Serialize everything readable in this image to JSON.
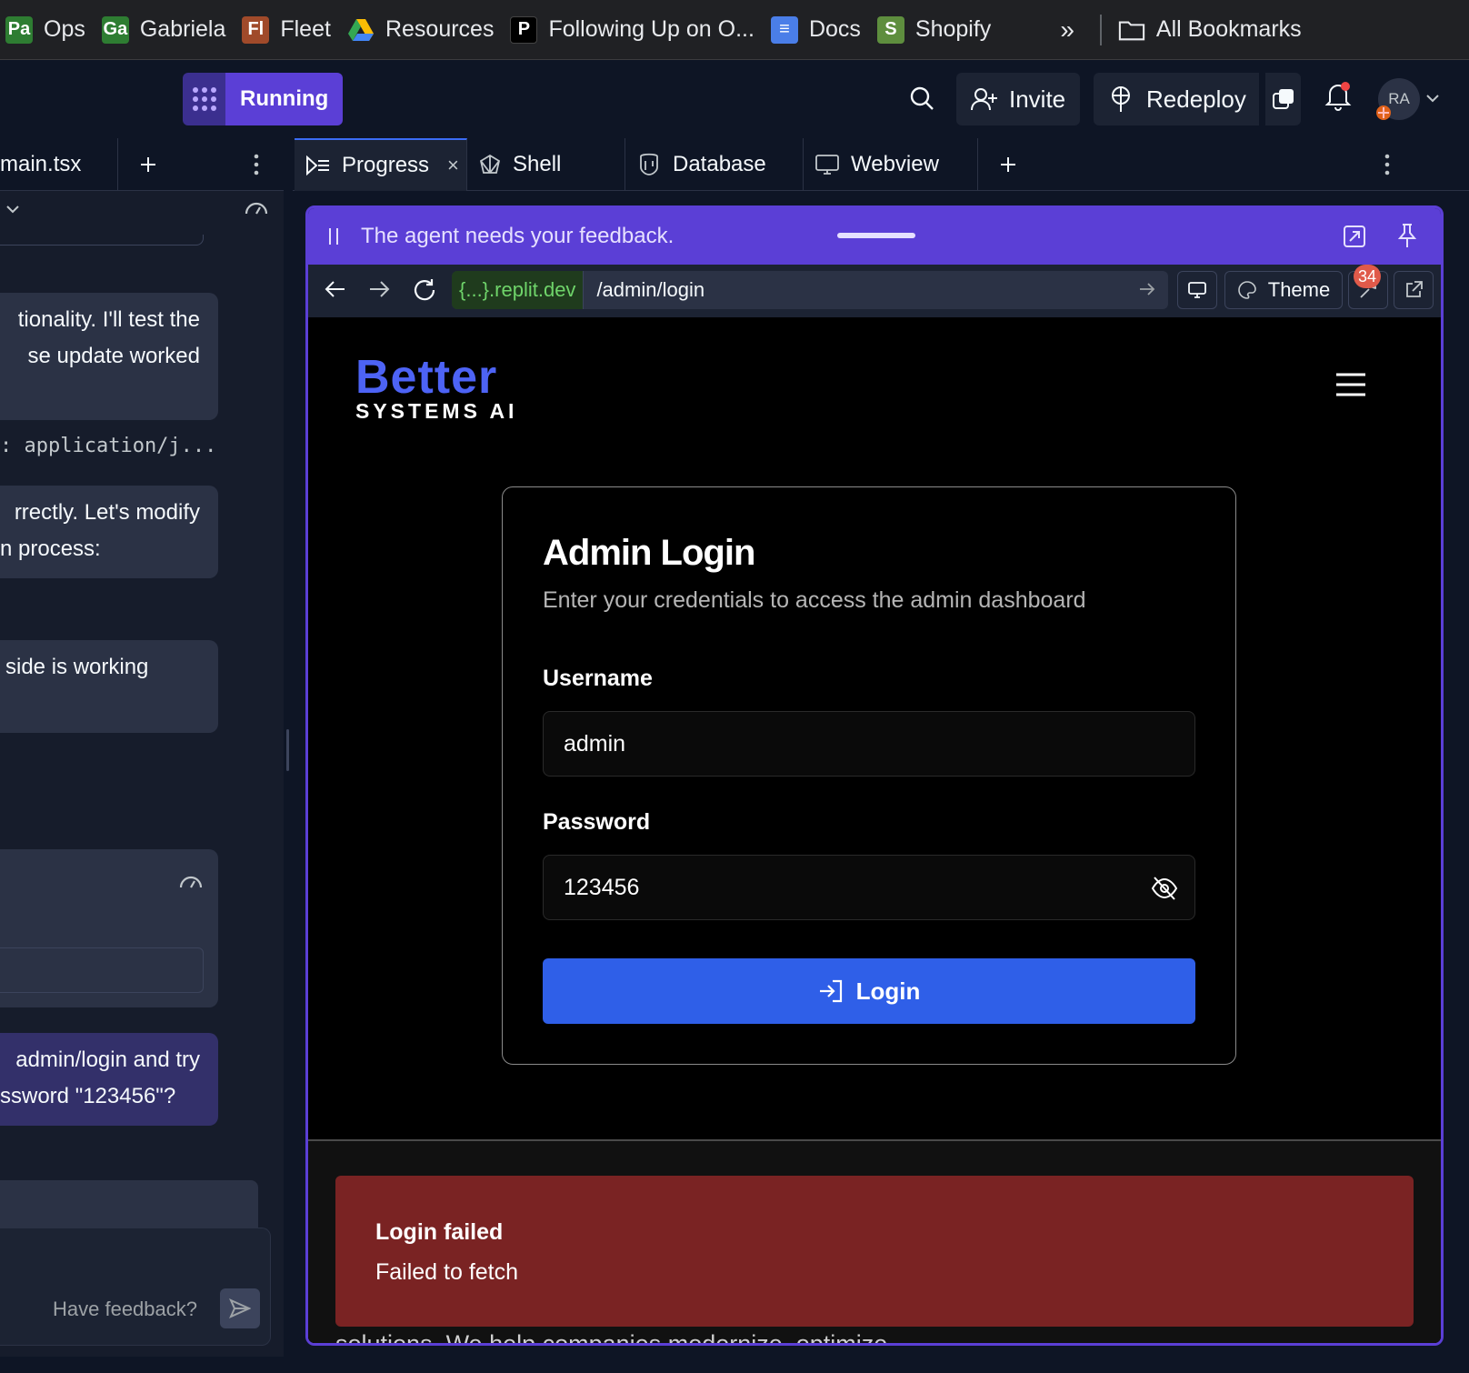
{
  "bookmarks": [
    {
      "label": "Ops",
      "badge": "Pa",
      "color": "#2e7d32"
    },
    {
      "label": "Gabriela",
      "badge": "Ga",
      "color": "#2e7d32"
    },
    {
      "label": "Fleet",
      "badge": "Fl",
      "color": "#a04a2a"
    },
    {
      "label": "Resources",
      "badge": "▲",
      "color": "#202124"
    },
    {
      "label": "Following Up on O...",
      "badge": "P",
      "color": "#000000"
    },
    {
      "label": "Docs",
      "badge": "≡",
      "color": "#4a7ee8"
    },
    {
      "label": "Shopify",
      "badge": "S",
      "color": "#5e8e3e"
    }
  ],
  "bookmarks_more": "»",
  "all_bookmarks": "All Bookmarks",
  "topbar": {
    "status": "Running",
    "invite": "Invite",
    "redeploy": "Redeploy",
    "avatar": "RA"
  },
  "left_panel": {
    "file_tab": "main.tsx",
    "messages": [
      {
        "lines": [
          "tionality. I'll test the",
          "se update worked"
        ]
      },
      {
        "lines": [
          "rrectly. Let's modify",
          "n process:"
        ]
      },
      {
        "lines": [
          "side is working"
        ]
      },
      {
        "lines": [
          "admin/login and try",
          "ssword \"123456\"?"
        ]
      }
    ],
    "code_snippet": ": application/j...",
    "feedback_placeholder": "Have feedback?"
  },
  "tabs": [
    {
      "label": "Progress",
      "icon": "progress-icon"
    },
    {
      "label": "Shell",
      "icon": "shell-icon"
    },
    {
      "label": "Database",
      "icon": "database-icon"
    },
    {
      "label": "Webview",
      "icon": "webview-icon"
    }
  ],
  "feedback_banner": "The agent needs your feedback.",
  "browser": {
    "domain_prefix": "{...}",
    "domain_suffix": ".replit.dev",
    "path": "/admin/login",
    "theme": "Theme",
    "devtools_badge": "34"
  },
  "site": {
    "logo_main": "Better",
    "logo_sub": "SYSTEMS AI",
    "card_title": "Admin Login",
    "card_subtitle": "Enter your credentials to access the admin dashboard",
    "username_label": "Username",
    "username_value": "admin",
    "password_label": "Password",
    "password_value": "123456",
    "login_button": "Login",
    "alert_title": "Login failed",
    "alert_message": "Failed to fetch",
    "behind_text": "solutions. We help companies modernize, optimize"
  },
  "colors": {
    "accent": "#5b3fd6",
    "login_button": "#2f5fe8",
    "alert_bg": "#7a2323",
    "logo_blue": "#4d63f5"
  }
}
